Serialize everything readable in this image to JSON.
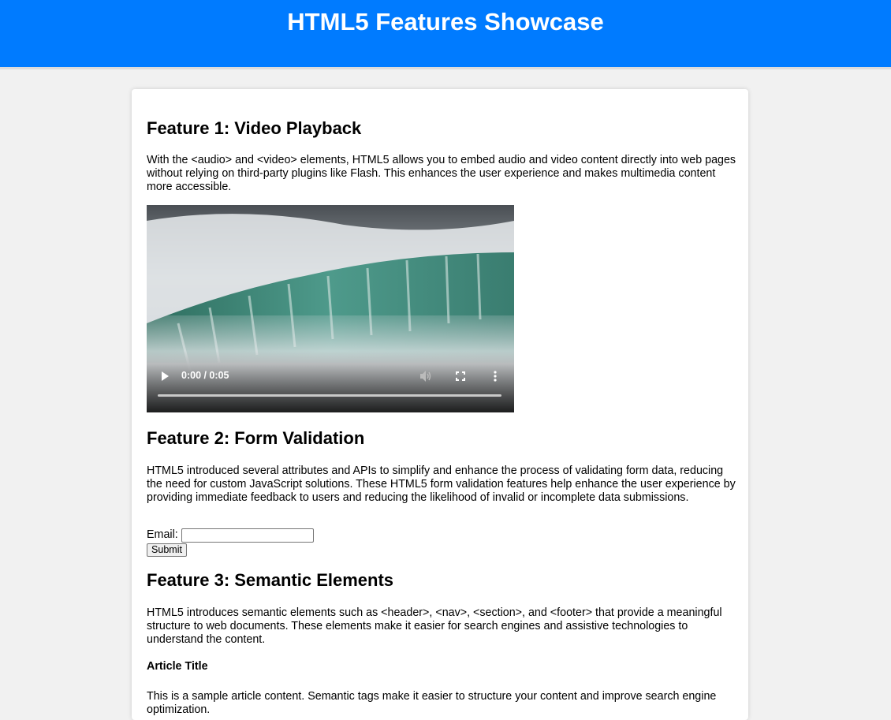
{
  "header": {
    "title": "HTML5 Features Showcase"
  },
  "features": [
    {
      "heading": "Feature 1: Video Playback",
      "text": "With the <audio> and <video> elements, HTML5 allows you to embed audio and video content directly into web pages without relying on third-party plugins like Flash. This enhances the user experience and makes multimedia content more accessible."
    },
    {
      "heading": "Feature 2: Form Validation",
      "text": "HTML5 introduced several attributes and APIs to simplify and enhance the process of validating form data, reducing the need for custom JavaScript solutions. These HTML5 form validation features help enhance the user experience by providing immediate feedback to users and reducing the likelihood of invalid or incomplete data submissions."
    },
    {
      "heading": "Feature 3: Semantic Elements",
      "text": "HTML5 introduces semantic elements such as <header>, <nav>, <section>, and <footer> that provide a meaningful structure to web documents. These elements make it easier for search engines and assistive technologies to understand the content."
    }
  ],
  "video": {
    "time_display": "0:00 / 0:05",
    "progress": 0,
    "play_icon": "play-icon",
    "volume_icon": "volume-icon",
    "fullscreen_icon": "fullscreen-icon",
    "more_icon": "more-options-icon"
  },
  "form": {
    "email_label": "Email:",
    "email_value": "",
    "submit_label": "Submit"
  },
  "article": {
    "title": "Article Title",
    "text": "This is a sample article content. Semantic tags make it easier to structure your content and improve search engine optimization."
  },
  "colors": {
    "header_bg": "#007bff",
    "page_bg": "#f1f1f1",
    "card_bg": "#ffffff"
  }
}
